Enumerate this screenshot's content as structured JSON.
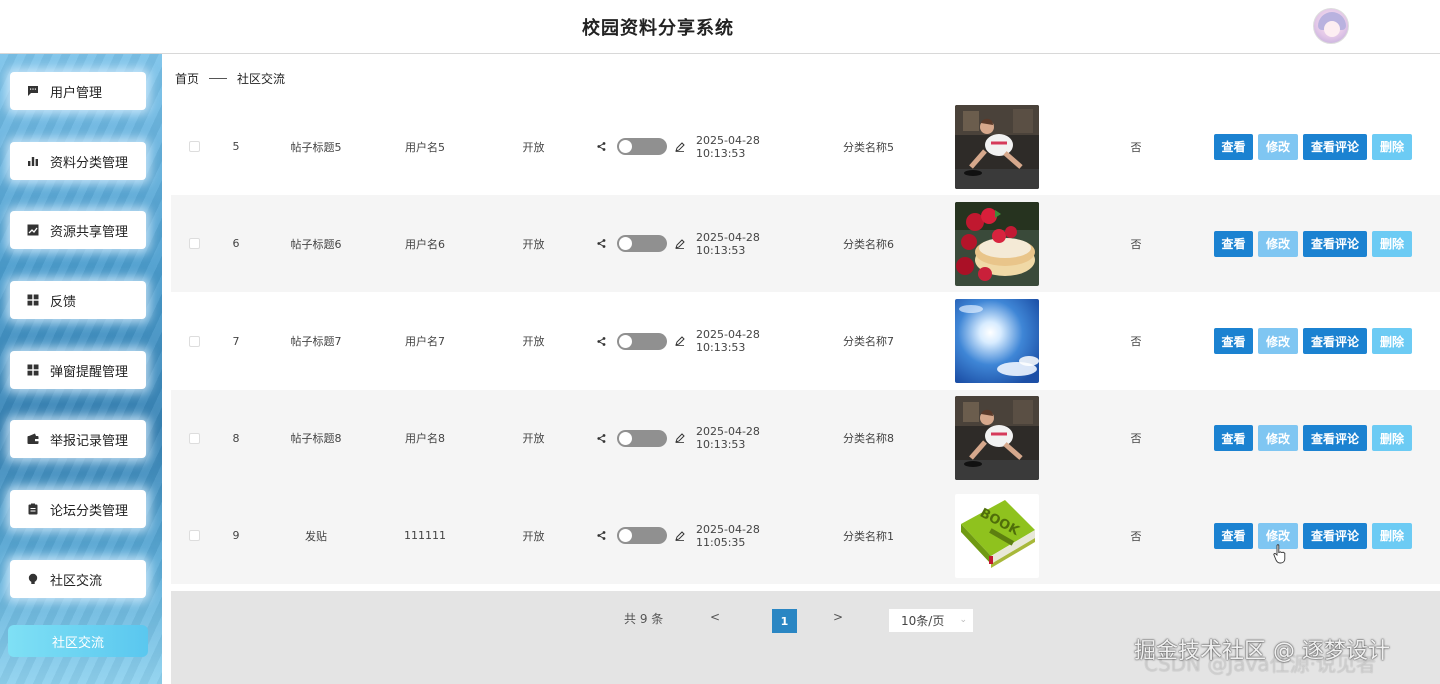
{
  "header": {
    "title": "校园资料分享系统",
    "avatar_icon": "anime-avatar-icon"
  },
  "sidebar": {
    "items": [
      {
        "label": "用户管理",
        "icon": "message-icon"
      },
      {
        "label": "资料分类管理",
        "icon": "bar-chart-icon"
      },
      {
        "label": "资源共享管理",
        "icon": "line-chart-icon"
      },
      {
        "label": "反馈",
        "icon": "grid-icon"
      },
      {
        "label": "弹窗提醒管理",
        "icon": "grid-icon"
      },
      {
        "label": "举报记录管理",
        "icon": "wallet-icon"
      },
      {
        "label": "论坛分类管理",
        "icon": "clipboard-icon"
      },
      {
        "label": "社区交流",
        "icon": "bulb-icon"
      }
    ],
    "sub_item": "社区交流"
  },
  "breadcrumb": {
    "home": "首页",
    "current": "社区交流"
  },
  "table": {
    "rows": [
      {
        "no": "5",
        "title": "帖子标题5",
        "user": "用户名5",
        "status": "开放",
        "time": "2025-04-28 10:13:53",
        "category": "分类名称5",
        "image": "gym-woman",
        "flag": "否"
      },
      {
        "no": "6",
        "title": "帖子标题6",
        "user": "用户名6",
        "status": "开放",
        "time": "2025-04-28 10:13:53",
        "category": "分类名称6",
        "image": "berry-cake",
        "flag": "否"
      },
      {
        "no": "7",
        "title": "帖子标题7",
        "user": "用户名7",
        "status": "开放",
        "time": "2025-04-28 10:13:53",
        "category": "分类名称7",
        "image": "sunny-sky",
        "flag": "否"
      },
      {
        "no": "8",
        "title": "帖子标题8",
        "user": "用户名8",
        "status": "开放",
        "time": "2025-04-28 10:13:53",
        "category": "分类名称8",
        "image": "gym-woman",
        "flag": "否"
      },
      {
        "no": "9",
        "title": "发贴",
        "user": "111111",
        "status": "开放",
        "time": "2025-04-28 11:05:35",
        "category": "分类名称1",
        "image": "book",
        "flag": "否"
      }
    ],
    "actions": {
      "view": "查看",
      "edit": "修改",
      "comments": "查看评论",
      "delete": "删除"
    }
  },
  "pagination": {
    "total": "共 9 条",
    "prev": "<",
    "current": "1",
    "next": ">",
    "page_size": "10条/页"
  },
  "watermark": {
    "primary": "掘金技术社区 @ 逐梦设计",
    "secondary": "CSDN @Java仕源·说见者"
  }
}
